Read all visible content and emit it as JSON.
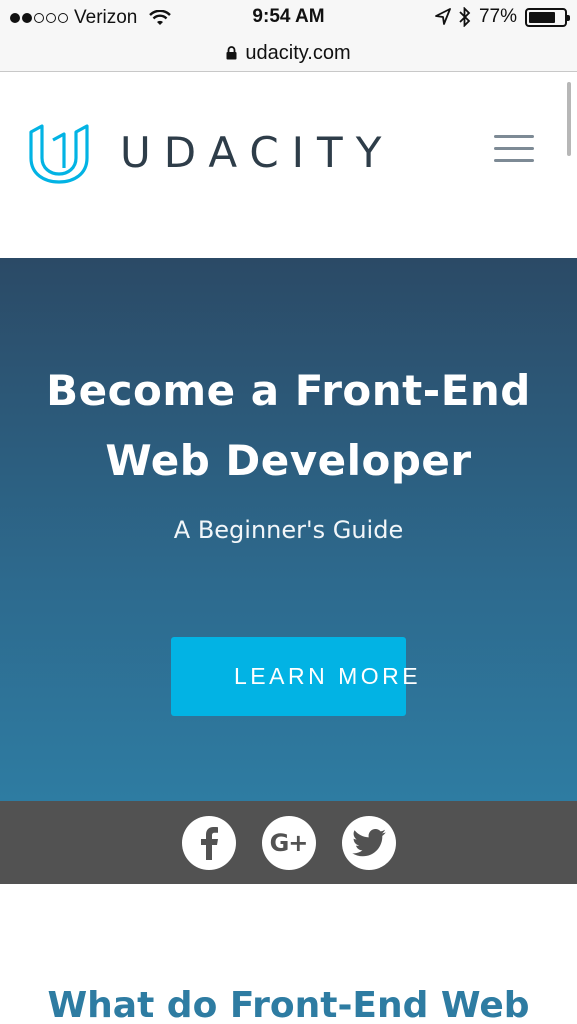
{
  "status_bar": {
    "carrier": "Verizon",
    "signal_bars_filled": 2,
    "signal_bars_total": 5,
    "time": "9:54 AM",
    "battery_percent": "77%",
    "battery_level": 0.77,
    "icons": [
      "wifi-icon",
      "location-arrow-icon",
      "bluetooth-icon",
      "battery-icon"
    ]
  },
  "browser": {
    "url": "udacity.com",
    "icons": [
      "lock-icon"
    ]
  },
  "header": {
    "logo_text": "UDACITY",
    "brand_color": "#02b3e4",
    "icons": [
      "udacity-logo-icon",
      "hamburger-menu-icon"
    ]
  },
  "hero": {
    "title_line1": "Become a Front-End",
    "title_line2": "Web Developer",
    "subtitle": "A Beginner's Guide",
    "cta_label": "LEARN MORE",
    "cta_color": "#02b3e4"
  },
  "social": {
    "items": [
      "facebook-icon",
      "google-plus-icon",
      "twitter-icon"
    ],
    "google_plus_text": "G+"
  },
  "section": {
    "heading": "What do Front-End Web"
  }
}
